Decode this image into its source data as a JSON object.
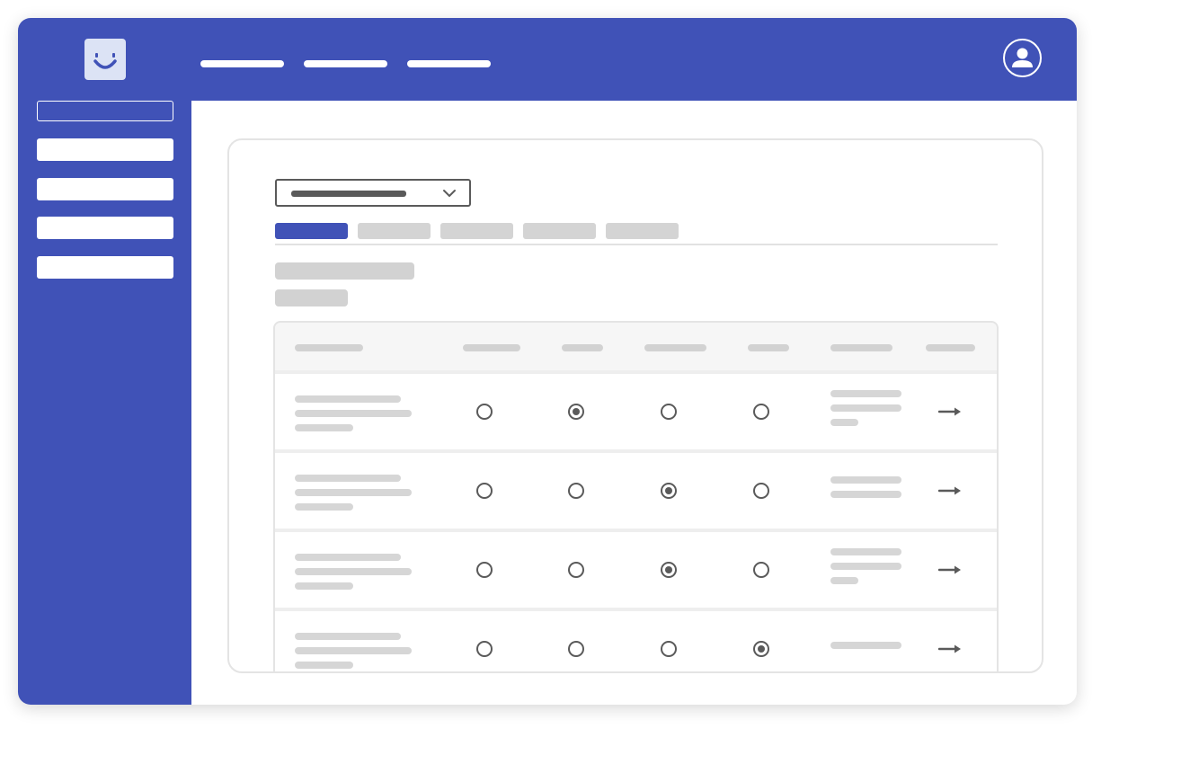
{
  "app": {
    "logo_icon": "smiley-face-icon",
    "account_icon": "user-circle-icon"
  },
  "colors": {
    "brand": "#4052b7",
    "placeholder": "#d2d2d2",
    "control": "#5a5a5a",
    "surface": "#ffffff",
    "logo_bg": "#dce3f5"
  },
  "topbar": {
    "nav_links": [
      "",
      "",
      ""
    ]
  },
  "sidebar": {
    "search": {
      "value": "",
      "placeholder": ""
    },
    "items": [
      "",
      "",
      "",
      ""
    ]
  },
  "main": {
    "dropdown": {
      "selected": "",
      "icon": "chevron-down-icon"
    },
    "tabs": [
      {
        "label": "",
        "active": true
      },
      {
        "label": "",
        "active": false
      },
      {
        "label": "",
        "active": false
      },
      {
        "label": "",
        "active": false
      },
      {
        "label": "",
        "active": false
      }
    ],
    "title": "",
    "subtitle": "",
    "table": {
      "columns": [
        "",
        "",
        "",
        "",
        "",
        "",
        ""
      ],
      "rows": [
        {
          "selected_option": 2,
          "description_lines": 3,
          "detail_lines": 3,
          "action_icon": "arrow-right-icon"
        },
        {
          "selected_option": 3,
          "description_lines": 3,
          "detail_lines": 2,
          "action_icon": "arrow-right-icon"
        },
        {
          "selected_option": 3,
          "description_lines": 3,
          "detail_lines": 3,
          "action_icon": "arrow-right-icon"
        },
        {
          "selected_option": 4,
          "description_lines": 3,
          "detail_lines": 1,
          "action_icon": "arrow-right-icon"
        }
      ]
    }
  }
}
